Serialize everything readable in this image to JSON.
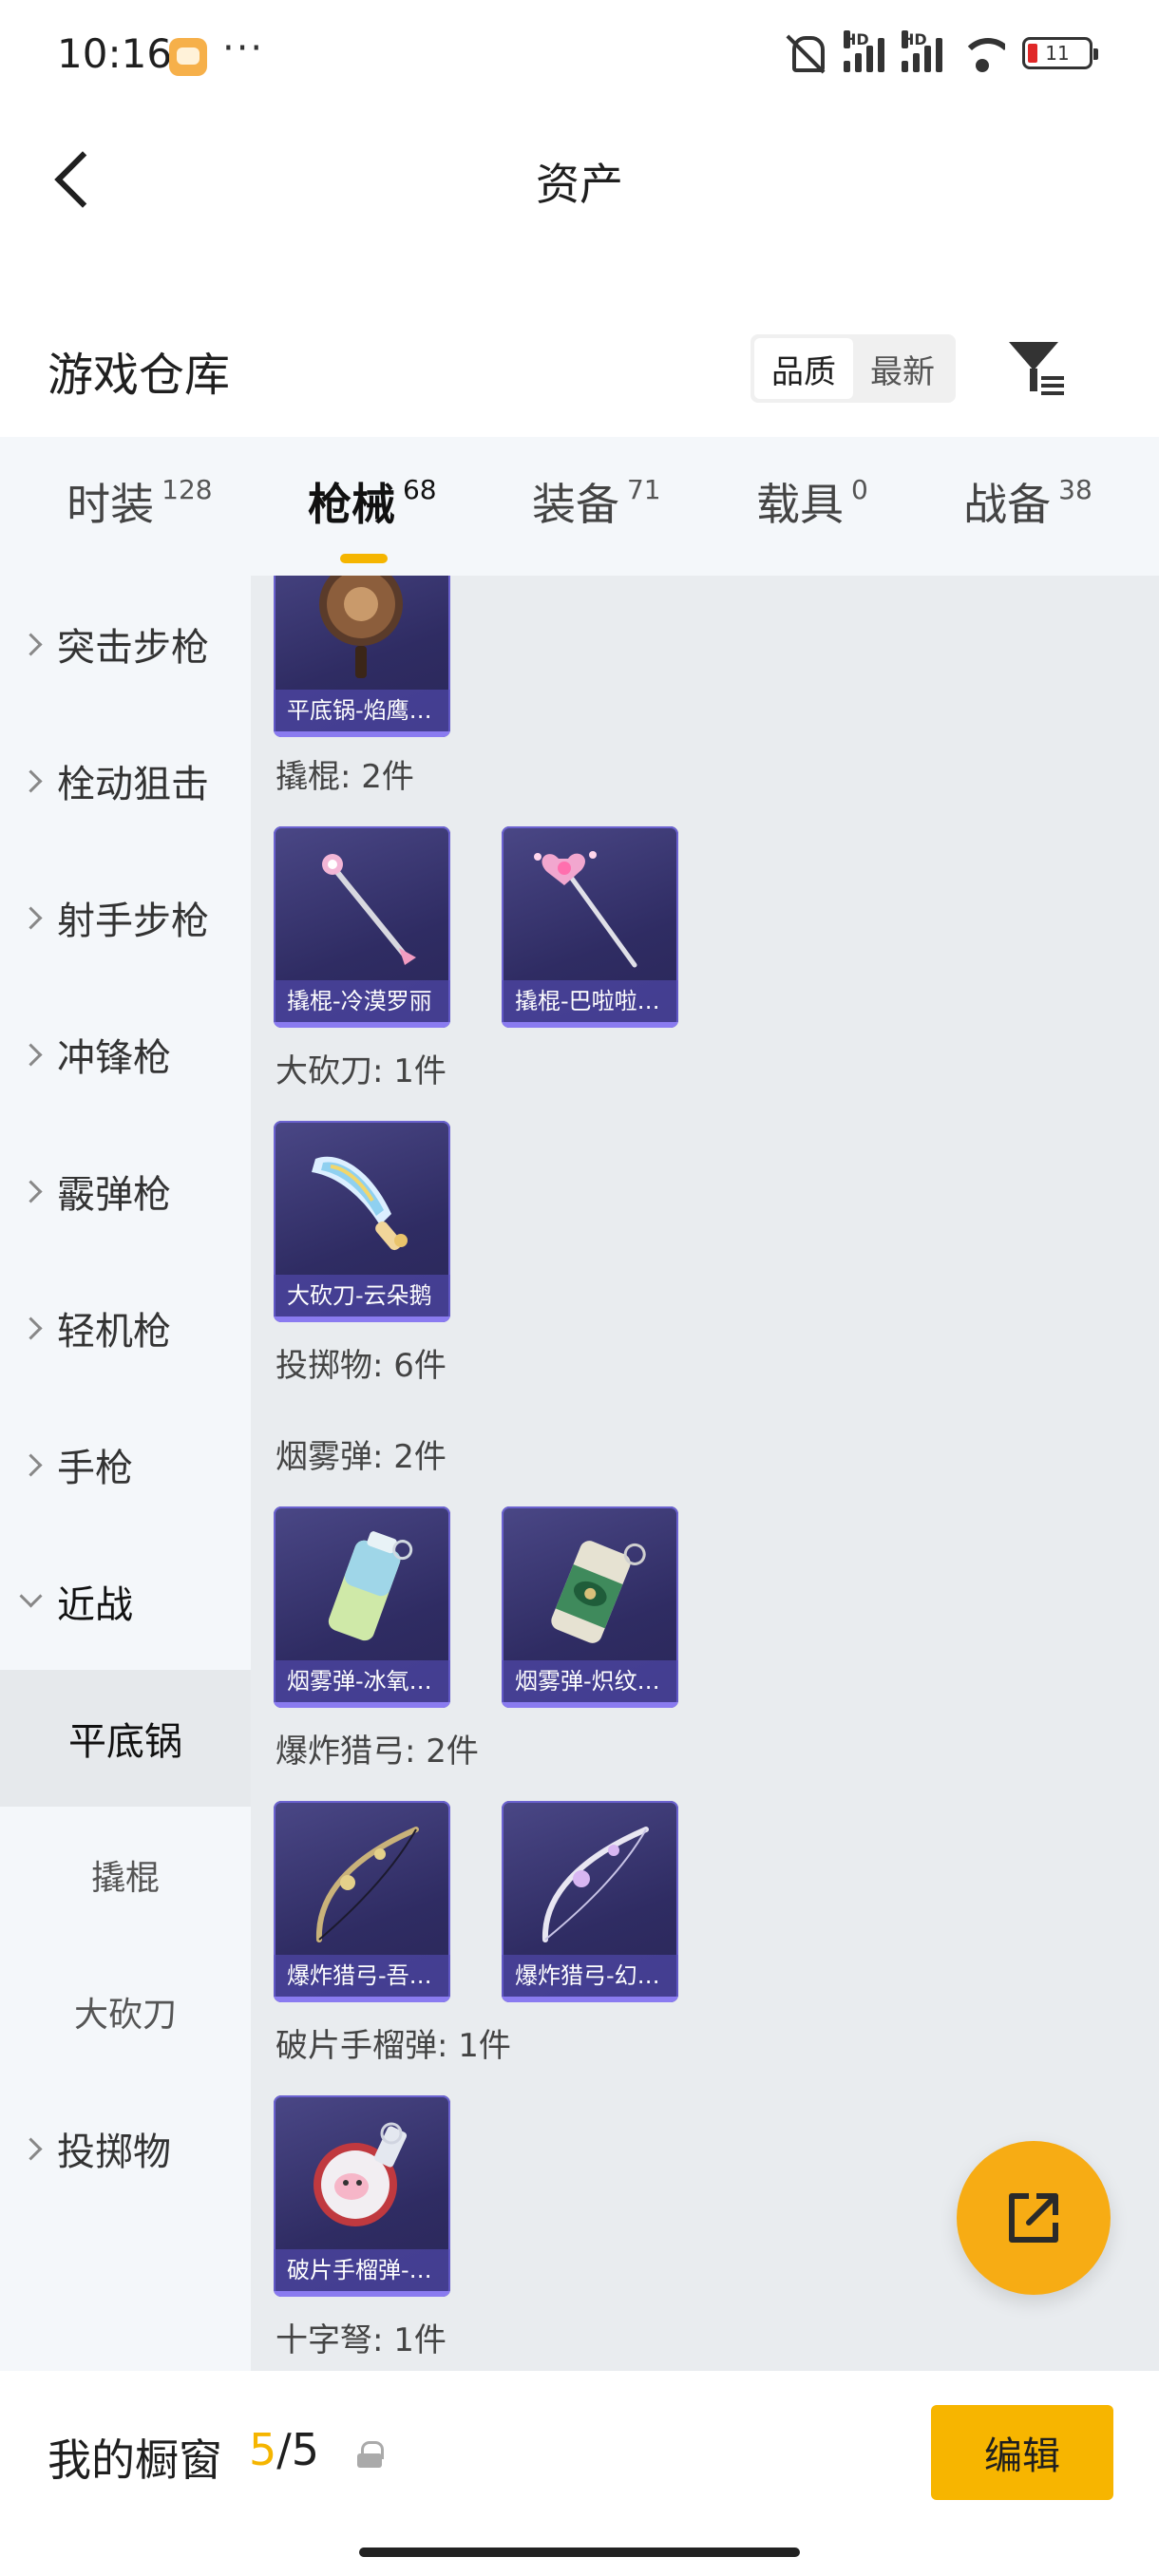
{
  "status": {
    "time": "10:16",
    "more": "···",
    "hd1": "HD",
    "hd2": "HD",
    "battery": "11"
  },
  "nav": {
    "title": "资产"
  },
  "warehouse": {
    "title": "游戏仓库",
    "sort_quality": "品质",
    "sort_newest": "最新",
    "sort_selected": "品质"
  },
  "tabs": [
    {
      "label": "时装",
      "count": "128"
    },
    {
      "label": "枪械",
      "count": "68",
      "active": true
    },
    {
      "label": "装备",
      "count": "71"
    },
    {
      "label": "载具",
      "count": "0"
    },
    {
      "label": "战备",
      "count": "38"
    }
  ],
  "sidebar": {
    "items": [
      {
        "label": "突击步枪"
      },
      {
        "label": "栓动狙击"
      },
      {
        "label": "射手步枪"
      },
      {
        "label": "冲锋枪"
      },
      {
        "label": "霰弹枪"
      },
      {
        "label": "轻机枪"
      },
      {
        "label": "手枪"
      },
      {
        "label": "近战",
        "expanded": true
      },
      {
        "label": "投掷物"
      }
    ],
    "sub_items": [
      {
        "label": "平底锅",
        "selected": true
      },
      {
        "label": "撬棍"
      },
      {
        "label": "大砍刀"
      }
    ]
  },
  "content": {
    "groups": [
      {
        "label": "撬棍: 2件"
      },
      {
        "label": "大砍刀: 1件"
      },
      {
        "label": "投掷物: 6件"
      },
      {
        "label": "烟雾弹: 2件"
      },
      {
        "label": "爆炸猎弓: 2件"
      },
      {
        "label": "破片手榴弹: 1件"
      },
      {
        "label": "十字弩: 1件"
      }
    ],
    "cards": [
      {
        "name": "平底锅-焰鹰…",
        "icon": "pan-icon"
      },
      {
        "name": "撬棍-冷漠罗丽",
        "icon": "crowbar-icon"
      },
      {
        "name": "撬棍-巴啦啦…",
        "icon": "magic-wand-icon"
      },
      {
        "name": "大砍刀-云朵鹅",
        "icon": "machete-icon"
      },
      {
        "name": "烟雾弹-冰氧…",
        "icon": "smoke-grenade-icon"
      },
      {
        "name": "烟雾弹-炽纹…",
        "icon": "smoke-grenade-icon"
      },
      {
        "name": "爆炸猎弓-吾…",
        "icon": "bow-icon"
      },
      {
        "name": "爆炸猎弓-幻…",
        "icon": "bow-icon"
      },
      {
        "name": "破片手榴弹-…",
        "icon": "frag-grenade-icon"
      }
    ]
  },
  "bottom": {
    "showcase_label": "我的橱窗",
    "showcase_current": "5",
    "showcase_total": "/5",
    "edit_label": "编辑"
  },
  "colors": {
    "accent": "#f7b500",
    "card_bg": "#2f2c63",
    "sidebar_bg": "#f4f7fa",
    "content_bg": "#e9ecef"
  }
}
